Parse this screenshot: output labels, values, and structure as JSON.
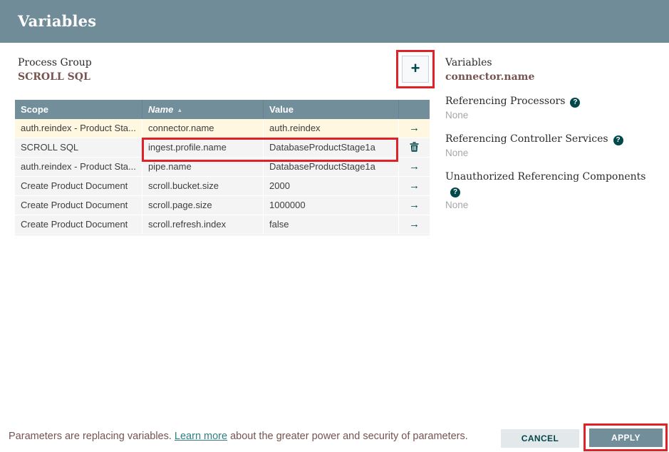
{
  "dialog": {
    "title": "Variables"
  },
  "process_group": {
    "label": "Process Group",
    "value": "SCROLL SQL"
  },
  "add_button": {
    "glyph": "+"
  },
  "table": {
    "columns": [
      {
        "label": "Scope"
      },
      {
        "label": "Name"
      },
      {
        "label": "Value"
      }
    ],
    "sort_indicator": "▲",
    "rows": [
      {
        "scope": "auth.reindex - Product Sta...",
        "name": "connector.name",
        "value": "auth.reindex",
        "action": "goto",
        "selected": true,
        "annotated": false
      },
      {
        "scope": "SCROLL SQL",
        "name": "ingest.profile.name",
        "value": "DatabaseProductStage1a",
        "action": "delete",
        "selected": false,
        "annotated": true
      },
      {
        "scope": "auth.reindex - Product Sta...",
        "name": "pipe.name",
        "value": "DatabaseProductStage1a",
        "action": "goto",
        "selected": false,
        "annotated": false
      },
      {
        "scope": "Create Product Document",
        "name": "scroll.bucket.size",
        "value": "2000",
        "action": "goto",
        "selected": false,
        "annotated": false
      },
      {
        "scope": "Create Product Document",
        "name": "scroll.page.size",
        "value": "1000000",
        "action": "goto",
        "selected": false,
        "annotated": false
      },
      {
        "scope": "Create Product Document",
        "name": "scroll.refresh.index",
        "value": "false",
        "action": "goto",
        "selected": false,
        "annotated": false
      }
    ]
  },
  "details_panel": {
    "variables_label": "Variables",
    "selected_variable": "connector.name",
    "help_glyph": "?",
    "sections": [
      {
        "label": "Referencing Processors",
        "value": "None"
      },
      {
        "label": "Referencing Controller Services",
        "value": "None"
      },
      {
        "label": "Unauthorized Referencing Components",
        "value": "None"
      }
    ]
  },
  "footer": {
    "message_before": "Parameters are replacing variables. ",
    "link_text": "Learn more",
    "message_after": " about the greater power and security of parameters.",
    "cancel_label": "CANCEL",
    "apply_label": "APPLY"
  },
  "colors": {
    "header_bar": "#708c99",
    "table_header": "#728e9b",
    "accent_teal": "#004849",
    "value_brown": "#775351",
    "selected_row": "#fff7e0",
    "row_bg": "#f4f4f4",
    "annotation_red": "#e02128",
    "cancel_bg": "#e3e8eb",
    "apply_bg": "#728e9b",
    "link_teal": "#2f7f83",
    "muted_text": "#a7a7a7"
  }
}
